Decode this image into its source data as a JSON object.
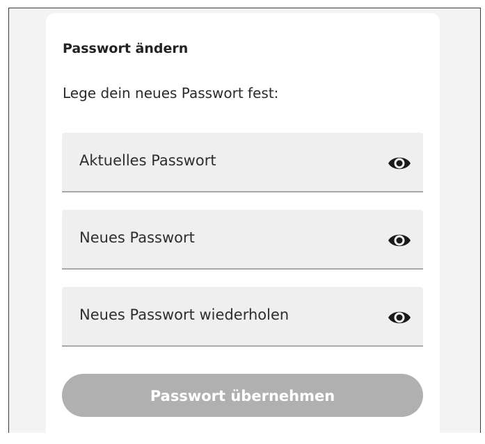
{
  "dialog": {
    "title": "Passwort ändern",
    "subtitle": "Lege dein neues Passwort fest:"
  },
  "fields": [
    {
      "placeholder": "Aktuelles Passwort",
      "icon": "eye-icon"
    },
    {
      "placeholder": "Neues Passwort",
      "icon": "eye-icon"
    },
    {
      "placeholder": "Neues Passwort wiederholen",
      "icon": "eye-icon"
    }
  ],
  "submit": {
    "label": "Passwort übernehmen",
    "enabled": false
  },
  "colors": {
    "field_background": "#efefef",
    "field_underline": "#a9a9a9",
    "button_disabled": "#b0b0b0",
    "text": "#222222"
  }
}
